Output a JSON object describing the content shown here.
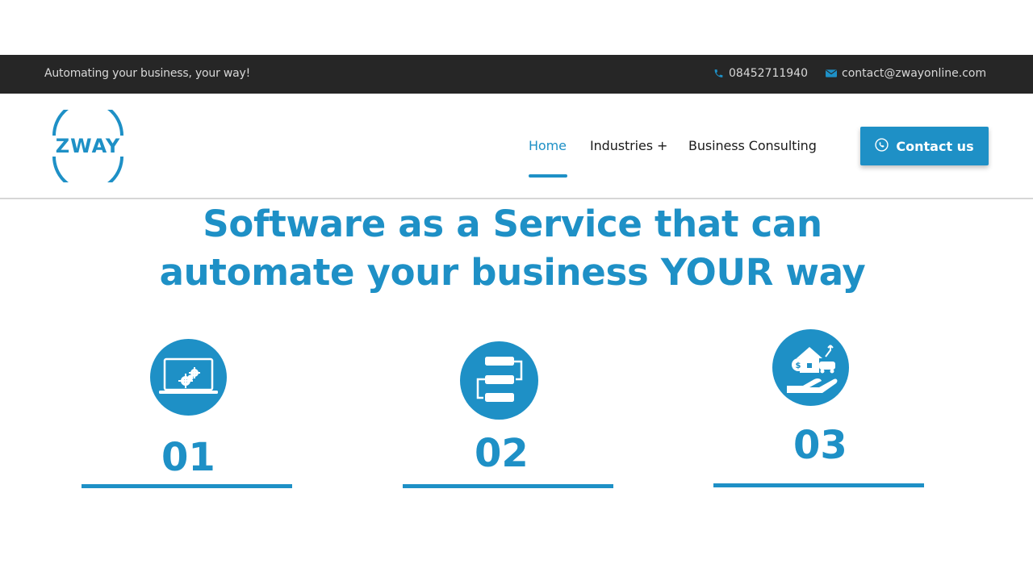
{
  "topbar": {
    "tagline": "Automating your business, your way!",
    "phone": "08452711940",
    "email": "contact@zwayonline.com"
  },
  "header": {
    "logo_text": "ZWAY",
    "nav": {
      "home": "Home",
      "industries": "Industries +",
      "consulting": "Business Consulting"
    },
    "contact_button": "Contact us"
  },
  "hero": {
    "line1": "Software as a Service that can",
    "line2": "automate your business YOUR way"
  },
  "features": [
    {
      "number": "01",
      "icon": "laptop-gears-icon"
    },
    {
      "number": "02",
      "icon": "flow-blocks-icon"
    },
    {
      "number": "03",
      "icon": "hand-property-icon"
    }
  ],
  "colors": {
    "accent": "#1e90c6",
    "topbar_bg": "#262626",
    "nav_text": "#1b1b1b"
  }
}
